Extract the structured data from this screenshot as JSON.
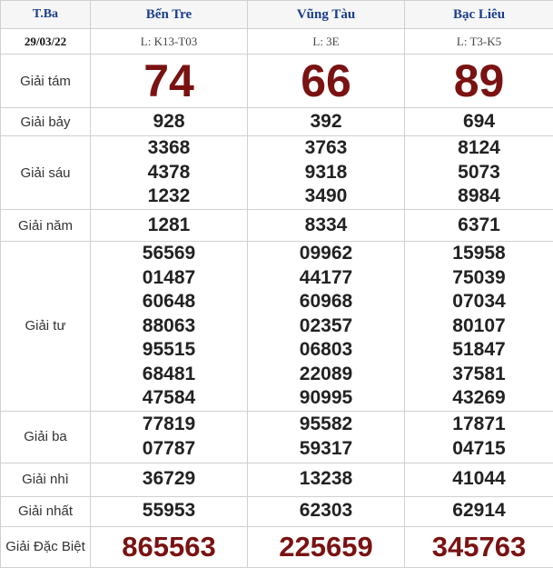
{
  "header": {
    "day": "T.Ba",
    "provinces": [
      "Bến Tre",
      "Vũng Tàu",
      "Bạc Liêu"
    ]
  },
  "subheader": {
    "date": "29/03/22",
    "codes": [
      "L: K13-T03",
      "L: 3E",
      "L: T3-K5"
    ]
  },
  "prizes": {
    "g8": {
      "label": "Giải tám",
      "values": [
        "74",
        "66",
        "89"
      ]
    },
    "g7": {
      "label": "Giải bảy",
      "values": [
        [
          "928"
        ],
        [
          "392"
        ],
        [
          "694"
        ]
      ]
    },
    "g6": {
      "label": "Giải sáu",
      "values": [
        [
          "3368",
          "4378",
          "1232"
        ],
        [
          "3763",
          "9318",
          "3490"
        ],
        [
          "8124",
          "5073",
          "8984"
        ]
      ]
    },
    "g5": {
      "label": "Giải năm",
      "values": [
        [
          "1281"
        ],
        [
          "8334"
        ],
        [
          "6371"
        ]
      ]
    },
    "g4": {
      "label": "Giải tư",
      "values": [
        [
          "56569",
          "01487",
          "60648",
          "88063",
          "95515",
          "68481",
          "47584"
        ],
        [
          "09962",
          "44177",
          "60968",
          "02357",
          "06803",
          "22089",
          "90995"
        ],
        [
          "15958",
          "75039",
          "07034",
          "80107",
          "51847",
          "37581",
          "43269"
        ]
      ]
    },
    "g3": {
      "label": "Giải ba",
      "values": [
        [
          "77819",
          "07787"
        ],
        [
          "95582",
          "59317"
        ],
        [
          "17871",
          "04715"
        ]
      ]
    },
    "g2": {
      "label": "Giải nhì",
      "values": [
        [
          "36729"
        ],
        [
          "13238"
        ],
        [
          "41044"
        ]
      ]
    },
    "g1": {
      "label": "Giải nhất",
      "values": [
        [
          "55953"
        ],
        [
          "62303"
        ],
        [
          "62914"
        ]
      ]
    },
    "gdb": {
      "label": "Giải Đặc Biệt",
      "values": [
        "865563",
        "225659",
        "345763"
      ]
    }
  },
  "colors": {
    "header_text": "#1a3e8c",
    "special_numbers": "#7a1212",
    "numbers": "#222222",
    "border": "#d0d0d0"
  }
}
